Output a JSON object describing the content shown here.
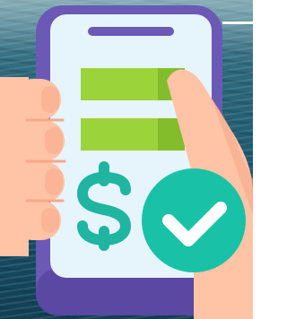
{
  "image": {
    "description_icon": "mobile-payment-approved-icon",
    "colors": {
      "phone_frame": "#6b59b5",
      "phone_frame_dark": "#5a48a3",
      "screen": "#e6f4fb",
      "speaker": "#6b59b5",
      "bars": "#9bd33a",
      "bars_shade": "#84bd2c",
      "dollar": "#1fb5a0",
      "hand": "#ffc3a6",
      "hand_shade": "#f5a98a",
      "check_circle": "#19c2a6",
      "check_circle_dark": "#10a88f",
      "checkmark": "#ffffff"
    }
  }
}
